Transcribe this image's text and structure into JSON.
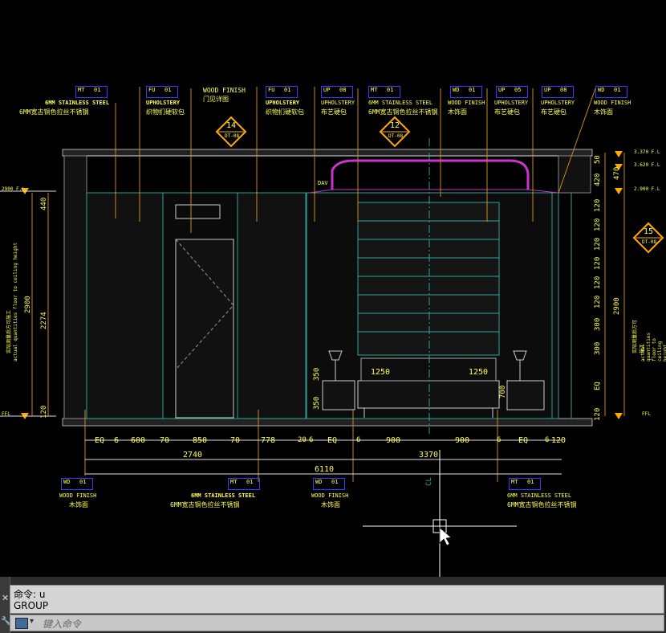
{
  "drawing": {
    "tags_top": [
      {
        "code": "MT",
        "num": "01",
        "en": "6MM STAINLESS STEEL",
        "cn": "6MM宽古铜色拉丝不锈钢"
      },
      {
        "code": "FU",
        "num": "01",
        "en": "UPHOLSTERY",
        "cn": "织物扪硬软包"
      },
      {
        "code": "",
        "num": "",
        "en": "WOOD FINISH",
        "cn": "门见详图"
      },
      {
        "code": "FU",
        "num": "01",
        "en": "UPHOLSTERY",
        "cn": "织物扪硬软包"
      },
      {
        "code": "UP",
        "num": "08",
        "en": "UPHOLSTERY",
        "cn": "布艺硬包"
      },
      {
        "code": "MT",
        "num": "01",
        "en": "6MM STAINLESS STEEL",
        "cn": "6MM宽古铜色拉丝不锈钢"
      },
      {
        "code": "WD",
        "num": "01",
        "en": "WOOD FINISH",
        "cn": "木饰面"
      },
      {
        "code": "UP",
        "num": "05",
        "en": "UPHOLSTERY",
        "cn": "布艺硬包"
      },
      {
        "code": "UP",
        "num": "08",
        "en": "UPHOLSTERY",
        "cn": "布艺硬包"
      },
      {
        "code": "WD",
        "num": "01",
        "en": "WOOD FINISH",
        "cn": "木饰面"
      }
    ],
    "tags_bottom": [
      {
        "code": "WD",
        "num": "01",
        "en": "WOOD FINISH",
        "cn": "木饰面"
      },
      {
        "code": "MT",
        "num": "01",
        "en": "6MM STAINLESS STEEL",
        "cn": "6MM宽古铜色拉丝不锈钢"
      },
      {
        "code": "WD",
        "num": "01",
        "en": "WOOD FINISH",
        "cn": "木饰面"
      },
      {
        "code": "MT",
        "num": "01",
        "en": "6MM STAINLESS STEEL",
        "cn": "6MM宽古铜色拉丝不锈钢"
      }
    ],
    "section_marks": [
      {
        "num": "14",
        "ref": "DT-08"
      },
      {
        "num": "12",
        "ref": "DT-08"
      },
      {
        "num": "15",
        "ref": "DT-08"
      }
    ],
    "level_left": [
      "2900 F.L",
      "FFL"
    ],
    "level_right": [
      "3.370 F.L",
      "3.620 F.L",
      "2.900 F.L",
      "FFL"
    ],
    "dims_left": [
      "440",
      "2274",
      "120",
      "2900"
    ],
    "dims_right": [
      "50",
      "470",
      "420",
      "120",
      "120",
      "120",
      "120",
      "120",
      "120",
      "120",
      "120",
      "300",
      "300",
      "EQ",
      "120",
      "2900"
    ],
    "dims_bottom_row1": [
      "EQ",
      "6",
      "600",
      "70",
      "850",
      "70",
      "778",
      "20",
      "6",
      "EQ",
      "6",
      "900",
      "900",
      "6",
      "EQ",
      "6",
      "120"
    ],
    "dims_bottom_row2": [
      "2740",
      "3370"
    ],
    "dims_bottom_row3": [
      "6110"
    ],
    "dims_bed": [
      "1250",
      "1250"
    ],
    "dims_night": [
      "350",
      "350",
      "700"
    ],
    "vertical_note_en": "actual quantities floor to ceiling height",
    "vertical_note_cn": "实际测量后方可施工",
    "small_label": "DAV",
    "centerline": "CL"
  },
  "command": {
    "history": [
      "命令: u",
      "GROUP"
    ],
    "placeholder": "键入命令",
    "close": "✕",
    "tool": "🔧"
  },
  "colors": {
    "background": "#000000",
    "wall_line": "#2aa59b",
    "tag_blue": "#3a3aff",
    "text_yellow": "#ffff55",
    "leader": "#c88a1a",
    "dim": "#d8a020",
    "magenta": "#cc33cc"
  }
}
